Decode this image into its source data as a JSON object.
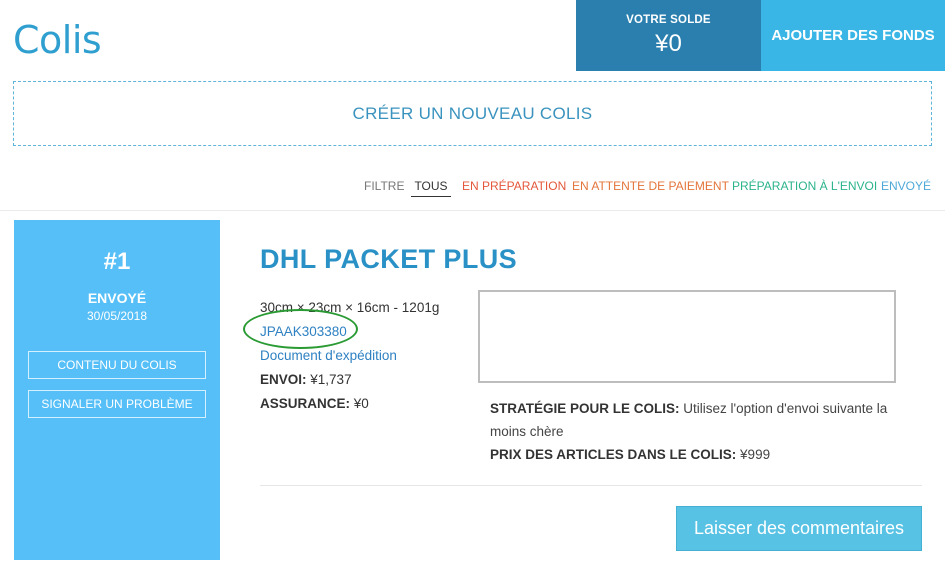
{
  "header": {
    "title": "Colis",
    "balance_label": "VOTRE SOLDE",
    "balance_value": "¥0",
    "add_funds_label": "AJOUTER DES FONDS"
  },
  "new_parcel_label": "CRÉER UN NOUVEAU COLIS",
  "filters": {
    "label": "FILTRE",
    "items": [
      {
        "label": "TOUS",
        "color": "#333333",
        "active": true
      },
      {
        "label": "EN PRÉPARATION",
        "color": "#e4573b"
      },
      {
        "label": "EN ATTENTE DE PAIEMENT",
        "color": "#e4753b"
      },
      {
        "label": "PRÉPARATION À L'ENVOI",
        "color": "#2bb38b"
      },
      {
        "label": "ENVOYÉ",
        "color": "#4fa9d8"
      }
    ]
  },
  "parcel": {
    "number": "#1",
    "status": "ENVOYÉ",
    "date": "30/05/2018",
    "contents_button": "CONTENU DU COLIS",
    "report_button": "SIGNALER UN PROBLÈME",
    "carrier": "DHL PACKET PLUS",
    "dimensions": "30cm × 23cm × 16cm - 1201g",
    "tracking": "JPAAK303380",
    "shipping_doc": "Document d'expédition",
    "shipping_label": "ENVOI:",
    "shipping_value": "¥1,737",
    "insurance_label": "ASSURANCE:",
    "insurance_value": "¥0",
    "strategy_label": "STRATÉGIE POUR LE COLIS:",
    "strategy_value": "Utilisez l'option d'envoi suivante la moins chère",
    "items_price_label": "PRIX DES ARTICLES DANS LE COLIS:",
    "items_price_value": "¥999",
    "feedback_button": "Laisser des commentaires"
  },
  "colors": {
    "accent": "#2f9fd0",
    "balance_bg": "#2a7fae",
    "add_funds_bg": "#39b6e6",
    "sidebar_bg": "#56bff7",
    "feedback_bg": "#57c2e4",
    "highlight_circle": "#2a9a33"
  }
}
